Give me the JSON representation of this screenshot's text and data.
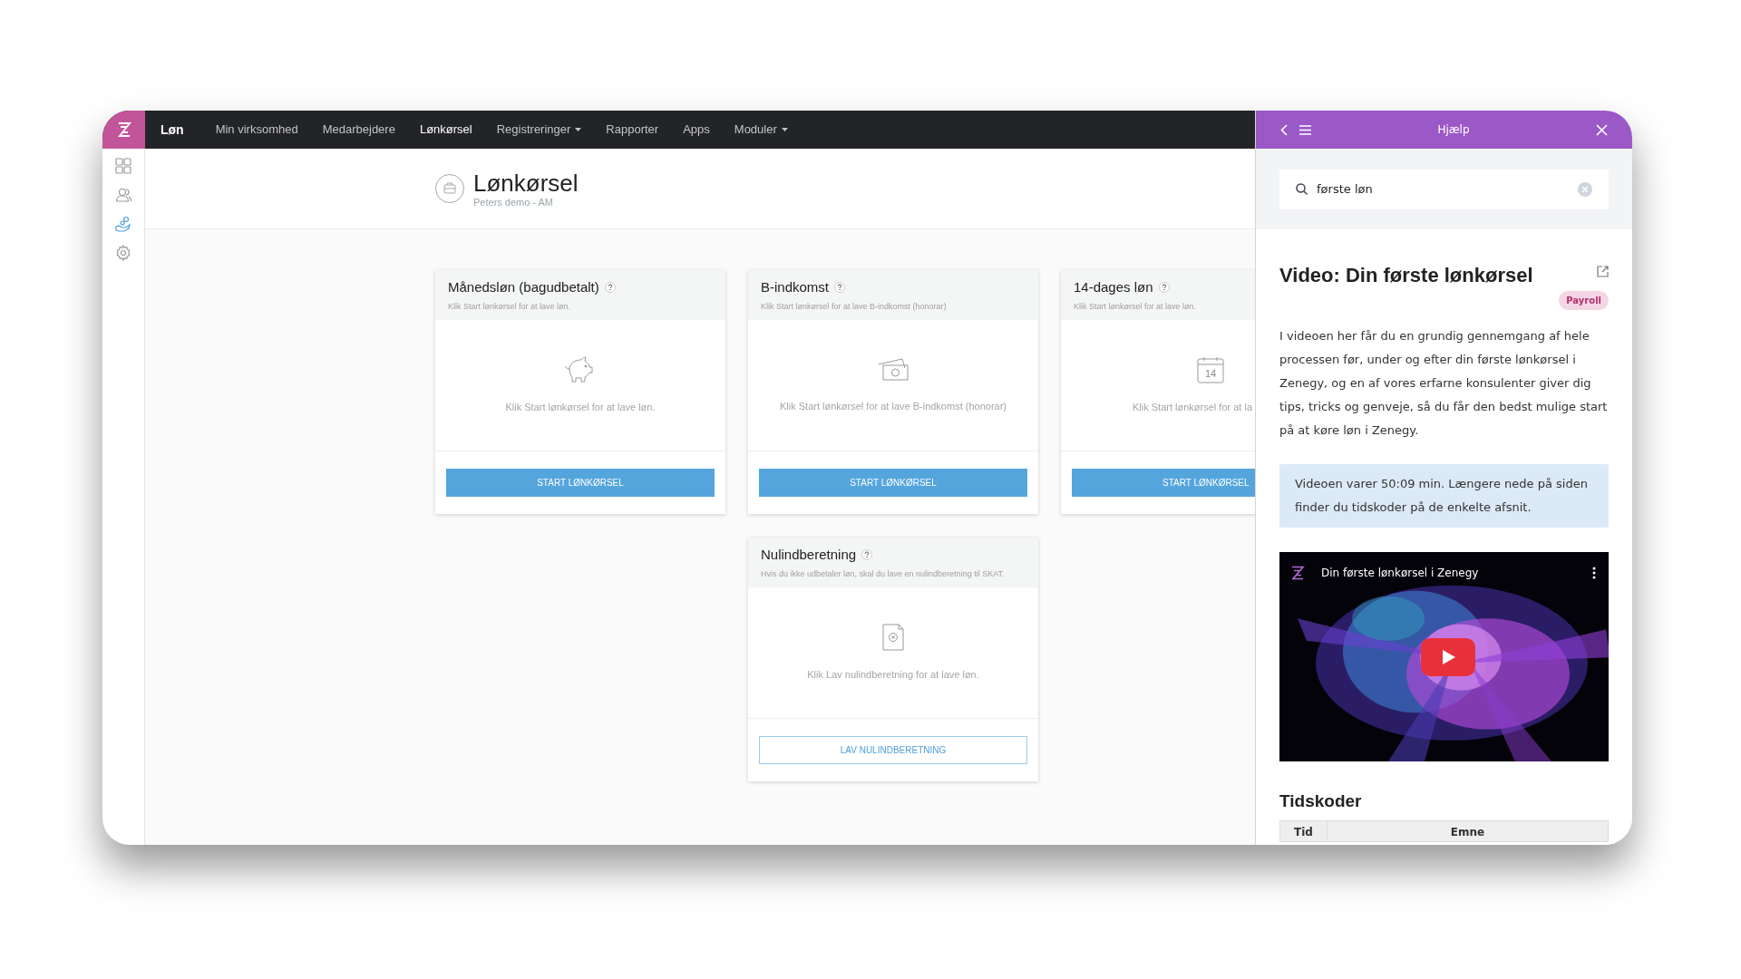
{
  "nav": {
    "section": "Løn",
    "items": [
      {
        "label": "Min virksomhed",
        "selected": false,
        "dropdown": false
      },
      {
        "label": "Medarbejdere",
        "selected": false,
        "dropdown": false
      },
      {
        "label": "Lønkørsel",
        "selected": true,
        "dropdown": false
      },
      {
        "label": "Registreringer",
        "selected": false,
        "dropdown": true
      },
      {
        "label": "Rapporter",
        "selected": false,
        "dropdown": false
      },
      {
        "label": "Apps",
        "selected": false,
        "dropdown": false
      },
      {
        "label": "Moduler",
        "selected": false,
        "dropdown": true
      }
    ]
  },
  "sidebar": {
    "items": [
      {
        "kind": "dashboard",
        "selected": false
      },
      {
        "kind": "people",
        "selected": false
      },
      {
        "kind": "payroll",
        "selected": true
      },
      {
        "kind": "settings",
        "selected": false
      }
    ]
  },
  "page": {
    "title": "Lønkørsel",
    "subtitle": "Peters demo - AM"
  },
  "card_rows": [
    {
      "cards": [
        {
          "title": "Månedsløn (bagudbetalt)",
          "subtitle": "Klik Start lønkørsel for at lave løn.",
          "kind": "piggy",
          "body": "Klik Start lønkørsel for at lave løn.",
          "button": {
            "label": "START LØNKØRSEL",
            "kind": "primary"
          },
          "cut": false
        },
        {
          "title": "B-indkomst",
          "subtitle": "Klik Start lønkørsel for at lave B-indkomst (honorar)",
          "kind": "money",
          "body": "Klik Start lønkørsel for at lave B-indkomst (honorar)",
          "button": {
            "label": "START LØNKØRSEL",
            "kind": "primary"
          },
          "cut": false
        },
        {
          "title": "14-dages løn",
          "subtitle": "Klik Start lønkørsel for at lave løn.",
          "kind": "calendar",
          "icon_label": "14",
          "body": "Klik Start lønkørsel for at la",
          "button": {
            "label": "START LØNKØRSEL",
            "kind": "primary"
          },
          "cut": true
        }
      ]
    },
    {
      "cards": [
        {
          "title": "Nulindberetning",
          "subtitle": "Hvis du ikke udbetaler løn, skal du lave en nulindberetning til SKAT.",
          "kind": "document",
          "body": "Klik Lav nulindberetning for at lave løn.",
          "button": {
            "label": "LAV NULINDBERETNING",
            "kind": "outline"
          },
          "cut": false
        }
      ]
    }
  ],
  "help": {
    "title": "Hjælp",
    "search": {
      "value": "første løn"
    },
    "article": {
      "title": "Video: Din første lønkørsel",
      "tag": "Payroll",
      "body": "I videoen her får du en grundig gennemgang af hele processen før, under og efter din første lønkørsel i Zenegy, og en af vores erfarne konsulenter giver dig tips, tricks og genveje, så du får den bedst mulige start på at køre løn i Zenegy.",
      "note": "Videoen varer 50:09 min. Længere nede på siden finder du tidskoder på de enkelte afsnit.",
      "video": {
        "title": "Din første lønkørsel i Zenegy"
      },
      "section_title": "Tidskoder",
      "table": {
        "columns": [
          "Tid",
          "Emne"
        ]
      }
    }
  }
}
